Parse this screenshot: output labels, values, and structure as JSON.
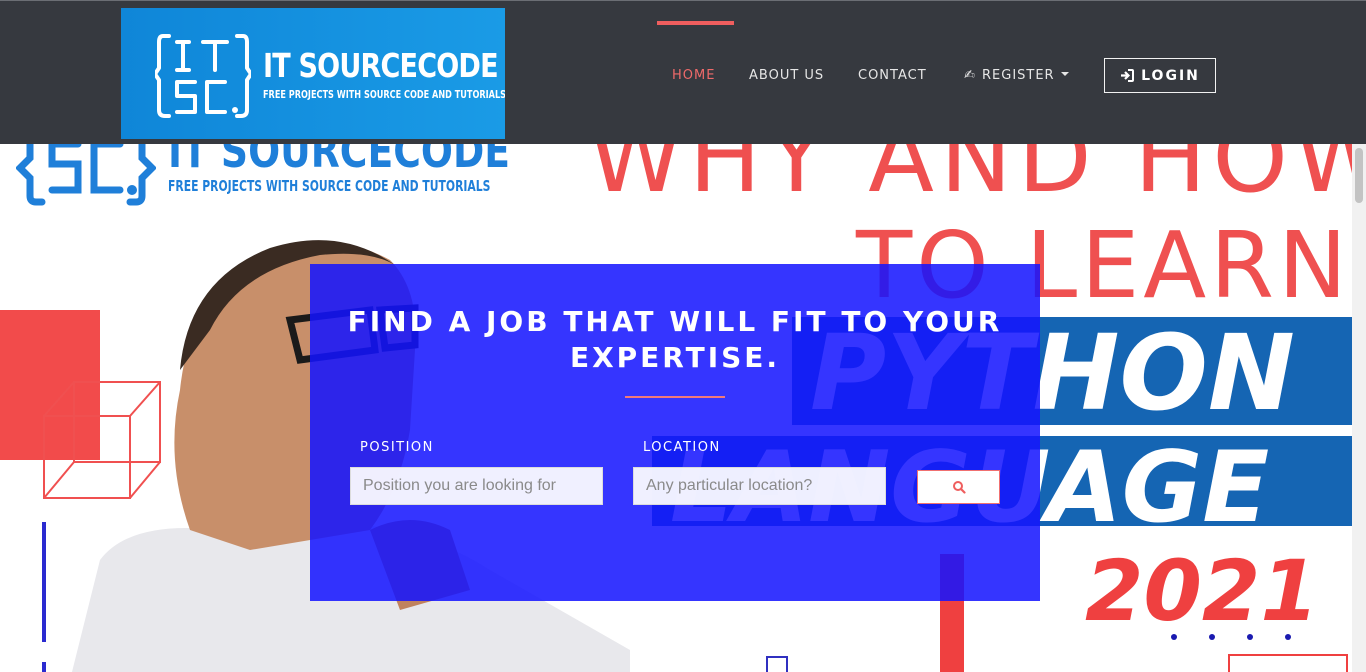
{
  "brand": {
    "name": "IT SOURCECODE",
    "tagline": "FREE PROJECTS WITH SOURCE CODE AND TUTORIALS",
    "logo_letters": [
      "I",
      "T",
      "S",
      "C",
      "."
    ]
  },
  "nav": {
    "items": [
      {
        "label": "HOME",
        "active": true
      },
      {
        "label": "ABOUT US",
        "active": false
      },
      {
        "label": "CONTACT",
        "active": false
      },
      {
        "label": "REGISTER",
        "active": false,
        "icon": "hand-icon",
        "dropdown": true
      }
    ],
    "login_label": "LOGIN",
    "login_icon": "sign-in-icon"
  },
  "hero_image": {
    "brand": "IT SOURCECODE",
    "tagline": "FREE PROJECTS WITH SOURCE CODE AND TUTORIALS",
    "line1": "WHY AND HOW",
    "line2": "TO LEARN",
    "line3": "PYTHON",
    "line4": "LANGUAGE",
    "year": "2021"
  },
  "search": {
    "title": "FIND A JOB THAT WILL FIT TO YOUR EXPERTISE.",
    "position_label": "POSITION",
    "position_placeholder": "Position you are looking for",
    "location_label": "LOCATION",
    "location_placeholder": "Any particular location?",
    "button_icon": "search-icon"
  },
  "colors": {
    "navbar_bg": "#36393f",
    "accent": "#ef5e5e",
    "brand_blue": "#0f86d8",
    "panel_blue": "#1414ff",
    "hero_red": "#ef5050",
    "hero_blue": "#1565b3"
  }
}
